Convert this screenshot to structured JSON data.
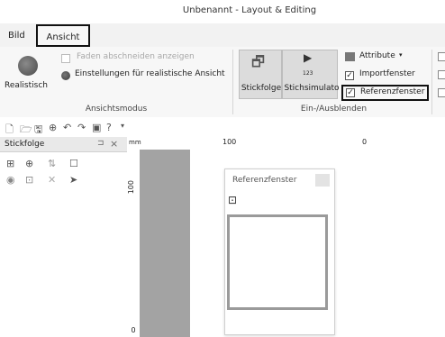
{
  "window": {
    "title": "Unbenannt - Layout & Editing"
  },
  "tabs": [
    {
      "label": "Bild"
    },
    {
      "label": "Ansicht"
    }
  ],
  "ribbon": {
    "realistisch_label": "Realistisch",
    "faden_label": "Faden abschneiden anzeigen",
    "einstellungen_label": "Einstellungen für realistische Ansicht",
    "ansichtsmodus_label": "Ansichtsmodus",
    "stickfolge_label": "Stickfolge",
    "stichsimulator_label": "Stichsimulato",
    "stichsim_number": "123",
    "attribute_label": "Attribute",
    "importfenster_label": "Importfenster",
    "referenzfenster_label": "Referenzfenster",
    "einaus_label": "Ein-/Ausblenden"
  },
  "panel": {
    "title": "Stickfolge",
    "pin": "⊐",
    "close": "×"
  },
  "ruler": {
    "unit": "mm",
    "label_100": "100",
    "label_0": "0",
    "left_label_100": "100",
    "left_label_0": "0"
  },
  "ref_window": {
    "title": "Referenzfenster"
  }
}
